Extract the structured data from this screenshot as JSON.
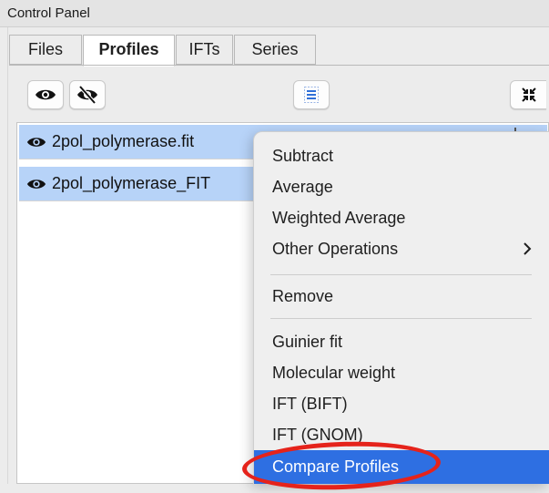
{
  "window": {
    "title": "Control Panel"
  },
  "tabs": [
    {
      "label": "Files",
      "active": false
    },
    {
      "label": "Profiles",
      "active": true
    },
    {
      "label": "IFTs",
      "active": false
    },
    {
      "label": "Series",
      "active": false
    }
  ],
  "toolbar": {
    "buttons": [
      {
        "icon": "eye-icon"
      },
      {
        "icon": "eye-slash-icon"
      },
      {
        "icon": "list-icon"
      },
      {
        "icon": "collapse-icon"
      }
    ]
  },
  "profiles": {
    "items": [
      {
        "name": "2pol_polymerase.fit",
        "visible_icon": "eye-icon",
        "selected": true
      },
      {
        "name": "2pol_polymerase_FIT",
        "visible_icon": "eye-icon",
        "selected": true
      }
    ]
  },
  "context_menu": {
    "items": [
      {
        "label": "Subtract"
      },
      {
        "label": "Average"
      },
      {
        "label": "Weighted Average"
      },
      {
        "label": "Other Operations",
        "submenu_icon": "chevron-right-icon"
      },
      {
        "label": "Remove"
      },
      {
        "label": "Guinier fit"
      },
      {
        "label": "Molecular weight"
      },
      {
        "label": "IFT (BIFT)"
      },
      {
        "label": "IFT (GNOM)"
      },
      {
        "label": "Compare Profiles",
        "highlighted": true
      }
    ]
  },
  "colors": {
    "selection": "#b7d3f8",
    "menu_highlight": "#2e6fe2",
    "annotation_ring": "#e5231b"
  }
}
